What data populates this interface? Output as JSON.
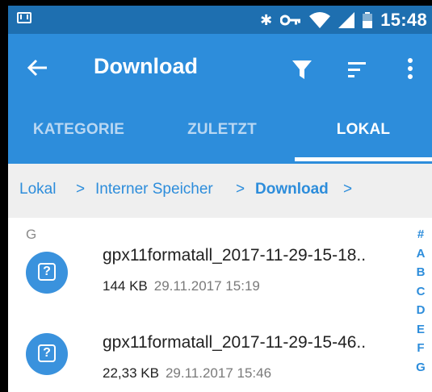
{
  "status_bar": {
    "time": "15:48",
    "icons": [
      "notification-icon",
      "bluetooth-icon",
      "vpn-key-icon",
      "wifi-icon",
      "cell-signal-icon",
      "battery-icon"
    ]
  },
  "app_bar": {
    "title": "Download",
    "colors": {
      "app_bar": "#2d8ddb",
      "status_bar": "#1e6fb0",
      "accent": "#2d8ddb"
    }
  },
  "tabs": [
    {
      "label": "KATEGORIE",
      "active": false
    },
    {
      "label": "ZULETZT",
      "active": false
    },
    {
      "label": "LOKAL",
      "active": true
    }
  ],
  "breadcrumb": {
    "items": [
      "Lokal",
      "Interner Speicher",
      "Download"
    ],
    "separator": ">"
  },
  "list": {
    "section_header": "G",
    "files": [
      {
        "name": "gpx11formatall_2017-11-29-15-18..",
        "size": "144 KB",
        "date": "29.11.2017 15:19"
      },
      {
        "name": "gpx11formatall_2017-11-29-15-46..",
        "size": "22,33 KB",
        "date": "29.11.2017 15:46"
      }
    ]
  },
  "alpha_index": [
    "#",
    "A",
    "B",
    "C",
    "D",
    "E",
    "F",
    "G"
  ]
}
